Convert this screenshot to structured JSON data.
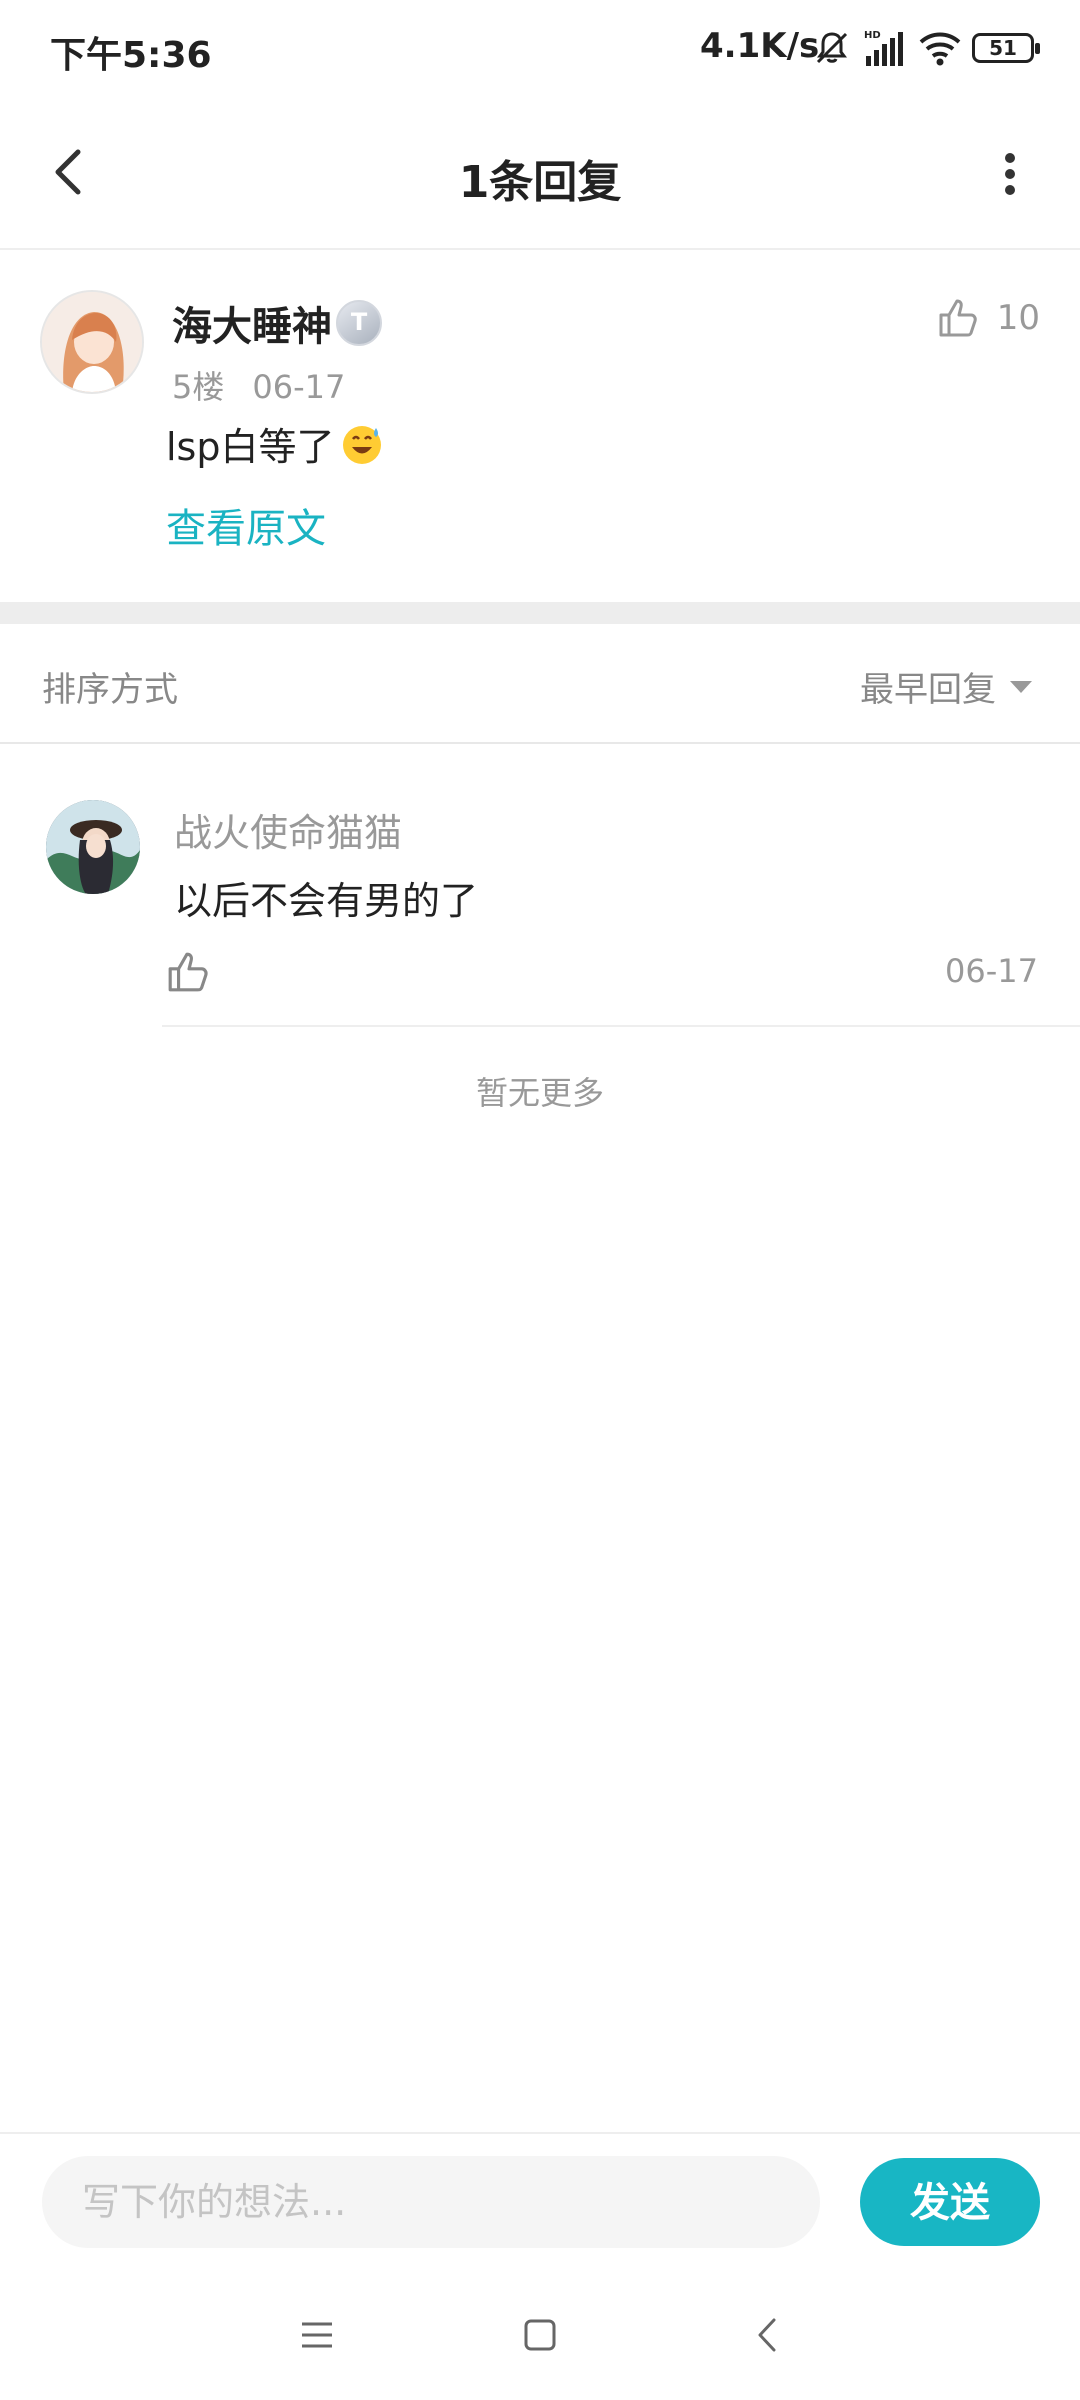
{
  "status_bar": {
    "time": "下午5:36",
    "net_speed": "4.1K/s",
    "battery": "51",
    "icons": [
      "mute-bell-icon",
      "hd-signal-icon",
      "wifi-icon",
      "battery-icon"
    ]
  },
  "header": {
    "title": "1条回复",
    "back_icon": "chevron-left-icon",
    "more_icon": "vertical-dots-icon"
  },
  "main_post": {
    "author": "海大睡神",
    "level_badge": "T",
    "floor": "5楼",
    "date": "06-17",
    "like_count": "10",
    "text": "lsp白等了",
    "emoji": "grinning-sweat-emoji",
    "view_original": "查看原文"
  },
  "sort": {
    "label": "排序方式",
    "value": "最早回复"
  },
  "replies": [
    {
      "author": "战火使命猫猫",
      "text": "以后不会有男的了",
      "date": "06-17"
    }
  ],
  "no_more": "暂无更多",
  "input_bar": {
    "placeholder": "写下你的想法...",
    "send_label": "发送"
  },
  "colors": {
    "accent": "#18b6c4",
    "link": "#1ab3c2",
    "muted_text": "#999999",
    "divider": "#eeeeee"
  }
}
